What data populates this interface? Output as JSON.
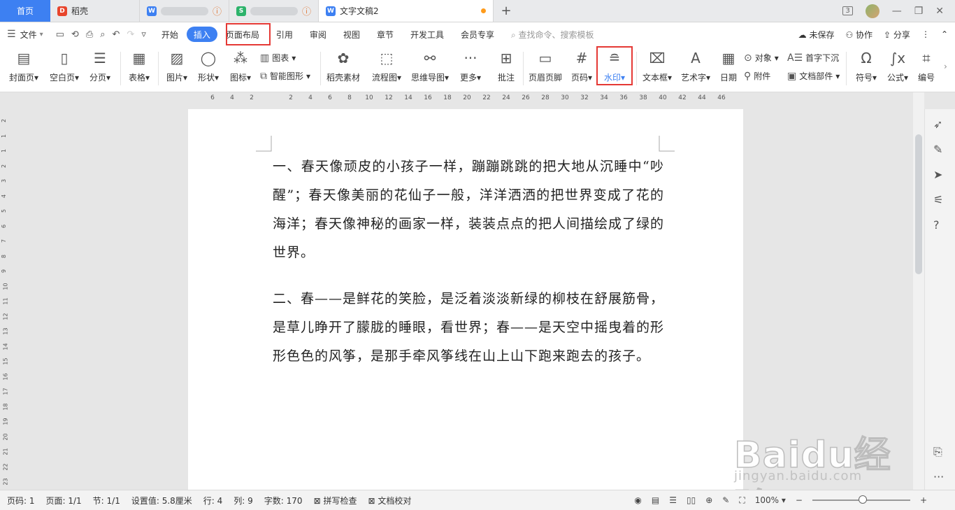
{
  "tabs": {
    "home": "首页",
    "daoke": "稻壳",
    "active_doc": "文字文稿2"
  },
  "window": {
    "badge_count": "3"
  },
  "menu": {
    "file": "文件",
    "items": [
      "开始",
      "插入",
      "页面布局",
      "引用",
      "审阅",
      "视图",
      "章节",
      "开发工具",
      "会员专享"
    ],
    "active_index": 1,
    "search_placeholder": "查找命令、搜索模板",
    "unsaved": "未保存",
    "collab": "协作",
    "share": "分享"
  },
  "ribbon": {
    "cover": "封面页",
    "blank": "空白页",
    "page_break": "分页",
    "table": "表格",
    "picture": "图片",
    "shape": "形状",
    "iconlib": "图标",
    "chart": "图表",
    "smart": "智能图形",
    "daoke_mat": "稻壳素材",
    "flow": "流程图",
    "mind": "思维导图",
    "more": "更多",
    "comment": "批注",
    "header_footer": "页眉页脚",
    "page_num": "页码",
    "watermark": "水印",
    "textbox": "文本框",
    "wordart": "艺术字",
    "date": "日期",
    "object": "对象",
    "attach": "附件",
    "dropcap": "首字下沉",
    "docpart": "文档部件",
    "symbol": "符号",
    "formula": "公式",
    "numbering": "编号"
  },
  "ruler": {
    "h_ticks": [
      "6",
      "4",
      "2",
      "2",
      "4",
      "6",
      "8",
      "10",
      "12",
      "14",
      "16",
      "18",
      "20",
      "22",
      "24",
      "26",
      "28",
      "30",
      "32",
      "34",
      "36",
      "38",
      "40",
      "42",
      "44",
      "46"
    ],
    "v_ticks": [
      "2",
      "1",
      "1",
      "2",
      "3",
      "4",
      "5",
      "6",
      "7",
      "8",
      "9",
      "10",
      "11",
      "12",
      "13",
      "14",
      "15",
      "16",
      "17",
      "18",
      "19",
      "20",
      "21",
      "22",
      "23"
    ]
  },
  "document": {
    "para1": "一、春天像顽皮的小孩子一样，蹦蹦跳跳的把大地从沉睡中“吵醒”；春天像美丽的花仙子一般，洋洋洒洒的把世界变成了花的海洋；春天像神秘的画家一样，装装点点的把人间描绘成了绿的世界。",
    "para2": "二、春——是鲜花的笑脸，是泛着淡淡新绿的柳枝在舒展筋骨，是草儿睁开了朦胧的睡眼，看世界；春——是天空中摇曳着的形形色色的风筝，是那手牵风筝线在山上山下跑来跑去的孩子。"
  },
  "status": {
    "page_code": "页码: 1",
    "pages": "页面: 1/1",
    "section": "节: 1/1",
    "setting": "设置值: 5.8厘米",
    "row": "行: 4",
    "col": "列: 9",
    "words": "字数: 170",
    "spellcheck": "拼写检查",
    "proof": "文档校对",
    "zoom": "100%"
  },
  "watermark": {
    "brand": "Baidu经验",
    "url": "jingyan.baidu.com"
  },
  "colors": {
    "accent": "#3d80f2",
    "highlight": "#e53935"
  }
}
